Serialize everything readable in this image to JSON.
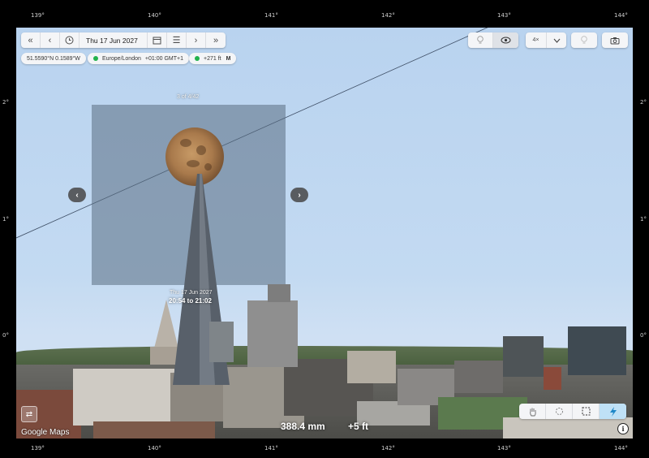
{
  "frame": {
    "top_ticks": [
      "139°",
      "140°",
      "141°",
      "142°",
      "143°",
      "144°"
    ],
    "bottom_ticks": [
      "139°",
      "140°",
      "141°",
      "142°",
      "143°",
      "144°"
    ],
    "left_ticks": [
      "2°",
      "1°",
      "0°"
    ],
    "right_ticks": [
      "2°",
      "1°",
      "0°"
    ]
  },
  "toolbar": {
    "date": "Thu 17 Jun 2027",
    "icons": [
      "rewind-icon",
      "step-back-icon",
      "clock-icon",
      "calendar-icon",
      "menu-icon",
      "step-forward-icon",
      "fast-forward-icon"
    ]
  },
  "chips": {
    "coordinates": "51.5590°N 0.1589°W",
    "timezone": "Europe/London",
    "timezone_offset": "+01:00 GMT+1",
    "elevation": "+271 ft",
    "elevation_mode": "M"
  },
  "right_toolbar": {
    "zoom_label": "4×"
  },
  "moon_panel": {
    "frame_counter": "3 of 4/42",
    "event_date": "Thu 17 Jun 2027",
    "event_time": "20:54 to 21:02"
  },
  "readouts": {
    "focal_length": "388.4 mm",
    "height_offset": "+5 ft"
  },
  "attribution": "Google Maps",
  "colors": {
    "sky": "#c3daf2",
    "toolbar_bg": "#f4f5f7",
    "status_green": "#22b24c",
    "lightning_button": "#bfe1f6",
    "lightning_icon": "#1e88c8"
  }
}
